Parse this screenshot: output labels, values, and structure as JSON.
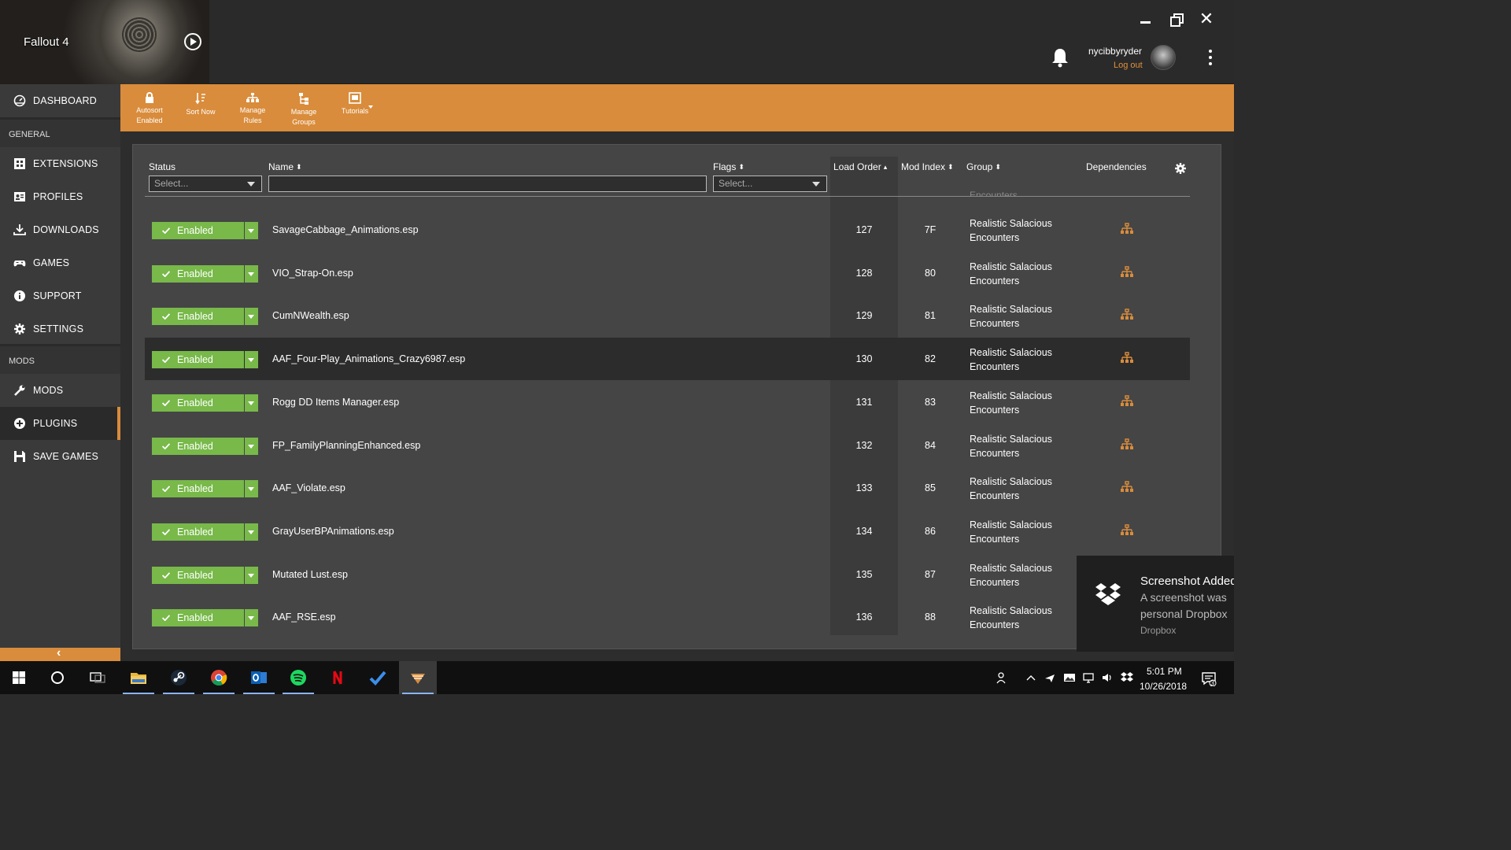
{
  "header": {
    "game_title": "Fallout 4",
    "username": "nycibbyryder",
    "logout_label": "Log out"
  },
  "sidebar": {
    "dashboard": "DASHBOARD",
    "general_section": "GENERAL",
    "items": [
      {
        "label": "EXTENSIONS",
        "icon": "extensions-icon"
      },
      {
        "label": "PROFILES",
        "icon": "profiles-icon"
      },
      {
        "label": "DOWNLOADS",
        "icon": "download-icon"
      },
      {
        "label": "GAMES",
        "icon": "gamepad-icon"
      },
      {
        "label": "SUPPORT",
        "icon": "info-icon"
      },
      {
        "label": "SETTINGS",
        "icon": "gear-icon"
      }
    ],
    "mods_section": "MODS",
    "mods_items": [
      {
        "label": "MODS",
        "icon": "wrench-icon"
      },
      {
        "label": "PLUGINS",
        "icon": "plus-circle-icon",
        "active": true
      },
      {
        "label": "SAVE GAMES",
        "icon": "floppy-icon"
      }
    ]
  },
  "toolbar": {
    "autosort": "Autosort",
    "autosort_sub": "Enabled",
    "sort_now": "Sort Now",
    "manage_rules": "Manage",
    "manage_rules_sub": "Rules",
    "manage_groups": "Manage",
    "manage_groups_sub": "Groups",
    "tutorials": "Tutorials"
  },
  "table": {
    "columns": {
      "status": "Status",
      "name": "Name",
      "flags": "Flags",
      "load_order": "Load Order",
      "mod_index": "Mod Index",
      "group": "Group",
      "dependencies": "Dependencies"
    },
    "status_filter_placeholder": "Select...",
    "flags_filter_placeholder": "Select...",
    "clipped_group_text": "Encounters",
    "rows": [
      {
        "status": "Enabled",
        "name": "SavageCabbage_Animations.esp",
        "load_order": "127",
        "mod_index": "7F",
        "group_line1": "Realistic Salacious",
        "group_line2": "Encounters"
      },
      {
        "status": "Enabled",
        "name": "VIO_Strap-On.esp",
        "load_order": "128",
        "mod_index": "80",
        "group_line1": "Realistic Salacious",
        "group_line2": "Encounters"
      },
      {
        "status": "Enabled",
        "name": "CumNWealth.esp",
        "load_order": "129",
        "mod_index": "81",
        "group_line1": "Realistic Salacious",
        "group_line2": "Encounters"
      },
      {
        "status": "Enabled",
        "name": "AAF_Four-Play_Animations_Crazy6987.esp",
        "load_order": "130",
        "mod_index": "82",
        "group_line1": "Realistic Salacious",
        "group_line2": "Encounters",
        "selected": true
      },
      {
        "status": "Enabled",
        "name": "Rogg DD Items Manager.esp",
        "load_order": "131",
        "mod_index": "83",
        "group_line1": "Realistic Salacious",
        "group_line2": "Encounters"
      },
      {
        "status": "Enabled",
        "name": "FP_FamilyPlanningEnhanced.esp",
        "load_order": "132",
        "mod_index": "84",
        "group_line1": "Realistic Salacious",
        "group_line2": "Encounters"
      },
      {
        "status": "Enabled",
        "name": "AAF_Violate.esp",
        "load_order": "133",
        "mod_index": "85",
        "group_line1": "Realistic Salacious",
        "group_line2": "Encounters"
      },
      {
        "status": "Enabled",
        "name": "GrayUserBPAnimations.esp",
        "load_order": "134",
        "mod_index": "86",
        "group_line1": "Realistic Salacious",
        "group_line2": "Encounters"
      },
      {
        "status": "Enabled",
        "name": "Mutated Lust.esp",
        "load_order": "135",
        "mod_index": "87",
        "group_line1": "Realistic Salacious",
        "group_line2": "Encounters"
      },
      {
        "status": "Enabled",
        "name": "AAF_RSE.esp",
        "load_order": "136",
        "mod_index": "88",
        "group_line1": "Realistic Salacious",
        "group_line2": "Encounters"
      }
    ]
  },
  "toast": {
    "title": "Screenshot Added",
    "line1": "A screenshot was",
    "line2": "personal Dropbox",
    "app": "Dropbox"
  },
  "taskbar": {
    "time": "5:01 PM",
    "date": "10/26/2018",
    "notification_count": "3",
    "apps": [
      "windows-start",
      "cortana",
      "task-view",
      "file-explorer",
      "steam",
      "chrome",
      "outlook",
      "spotify",
      "netflix",
      "todo",
      "vortex"
    ]
  },
  "colors": {
    "accent": "#d98c3b",
    "enabled_green": "#78b94a",
    "sidebar_bg": "#3a3a3a",
    "panel_bg": "#454545"
  }
}
